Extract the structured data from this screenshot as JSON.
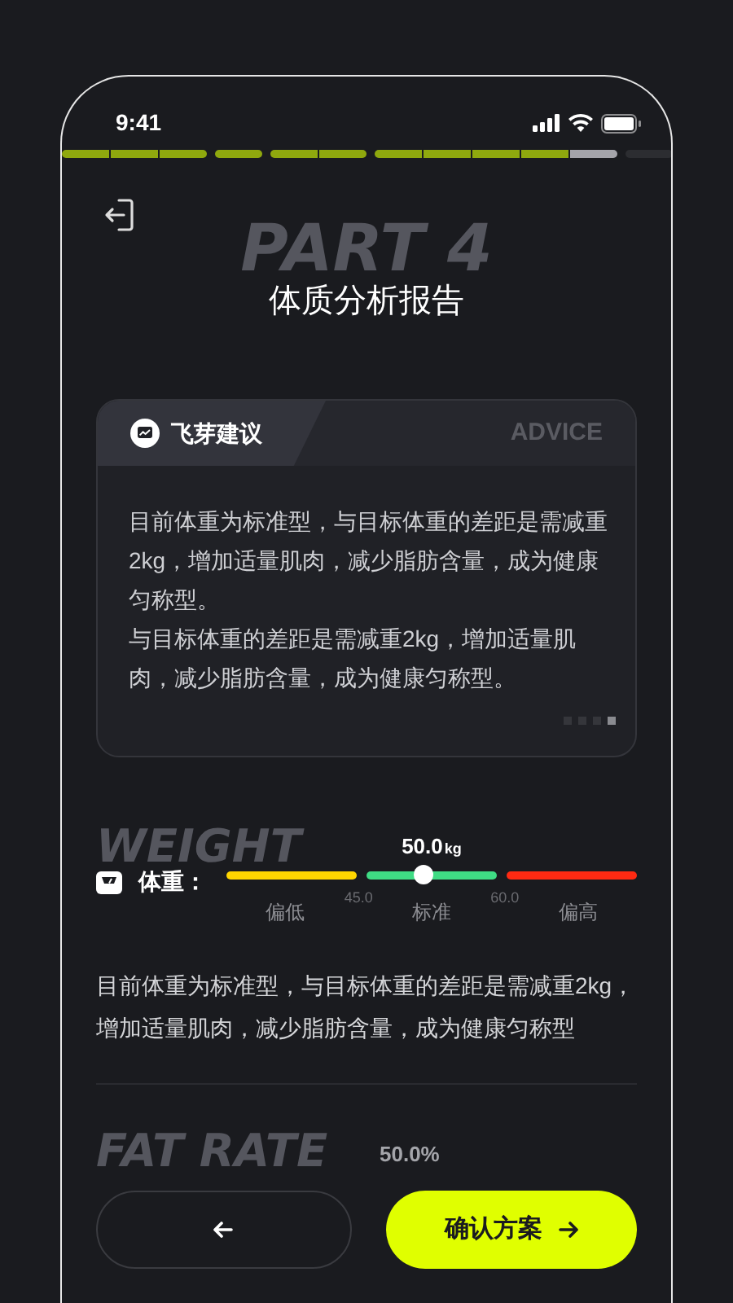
{
  "status_bar": {
    "time": "9:41"
  },
  "progress": [
    {
      "segments": [
        {
          "done": true,
          "current": false
        },
        {
          "done": true,
          "current": false
        },
        {
          "done": true,
          "current": false
        }
      ]
    },
    {
      "segments": [
        {
          "done": true,
          "current": false
        }
      ]
    },
    {
      "segments": [
        {
          "done": true,
          "current": false
        },
        {
          "done": true,
          "current": false
        }
      ]
    },
    {
      "segments": [
        {
          "done": true,
          "current": false
        },
        {
          "done": true,
          "current": false
        },
        {
          "done": true,
          "current": false
        },
        {
          "done": true,
          "current": false
        },
        {
          "done": false,
          "current": true
        }
      ]
    },
    {
      "segments": [
        {
          "done": false,
          "current": false
        }
      ]
    }
  ],
  "header": {
    "watermark": "PART 4",
    "title": "体质分析报告"
  },
  "advice_card": {
    "title": "飞芽建议",
    "watermark": "ADVICE",
    "paragraphs": [
      "目前体重为标准型，与目标体重的差距是需减重2kg，增加适量肌肉，减少脂肪含量，成为健康匀称型。",
      "与目标体重的差距是需减重2kg，增加适量肌肉，减少脂肪含量，成为健康匀称型。"
    ],
    "pages": [
      {
        "selected": false
      },
      {
        "selected": false
      },
      {
        "selected": false
      },
      {
        "selected": true
      }
    ]
  },
  "weight": {
    "watermark": "WEIGHT",
    "label": "体重：",
    "value": "50.0",
    "unit": "kg",
    "level": 0.48,
    "zones": [
      {
        "label": "偏低",
        "color": "#ffd600"
      },
      {
        "label": "标准",
        "color": "#3fdc84"
      },
      {
        "label": "偏高",
        "color": "#ff2a12"
      }
    ],
    "thresholds": [
      "45.0",
      "60.0"
    ],
    "summary": "目前体重为标准型，与目标体重的差距是需减重2kg，增加适量肌肉，减少脂肪含量，成为健康匀称型"
  },
  "fat_rate": {
    "watermark": "FAT RATE",
    "value": "50.0%"
  },
  "buttons": {
    "confirm": "确认方案"
  }
}
